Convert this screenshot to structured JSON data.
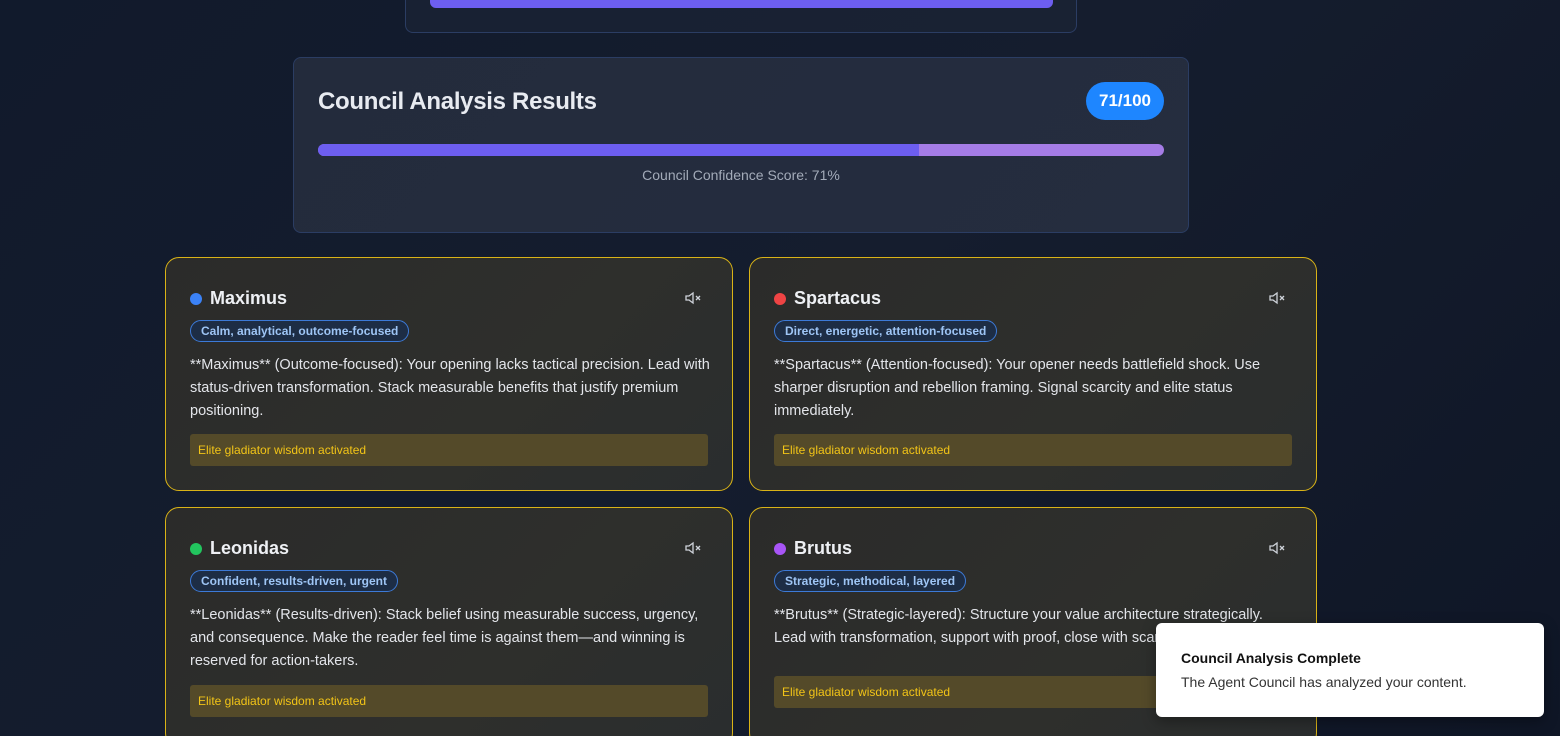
{
  "results": {
    "title": "Council Analysis Results",
    "score_badge": "71/100",
    "confidence_percent": 71,
    "score_label": "Council Confidence Score: 71%"
  },
  "agents": [
    {
      "name": "Maximus",
      "dot_color": "#3b82f6",
      "tag": "Calm, analytical, outcome-focused",
      "text": "**Maximus** (Outcome-focused): Your opening lacks tactical precision. Lead with status-driven transformation. Stack measurable benefits that justify premium positioning.",
      "banner": "Elite gladiator wisdom activated",
      "mute_icon": "speaker-muted-icon"
    },
    {
      "name": "Spartacus",
      "dot_color": "#ef4444",
      "tag": "Direct, energetic, attention-focused",
      "text": "**Spartacus** (Attention-focused): Your opener needs battlefield shock. Use sharper disruption and rebellion framing. Signal scarcity and elite status immediately.",
      "banner": "Elite gladiator wisdom activated",
      "mute_icon": "speaker-muted-icon"
    },
    {
      "name": "Leonidas",
      "dot_color": "#22c55e",
      "tag": "Confident, results-driven, urgent",
      "text": "**Leonidas** (Results-driven): Stack belief using measurable success, urgency, and consequence. Make the reader feel time is against them—and winning is reserved for action-takers.",
      "banner": "Elite gladiator wisdom activated",
      "mute_icon": "speaker-muted-icon"
    },
    {
      "name": "Brutus",
      "dot_color": "#a855f7",
      "tag": "Strategic, methodical, layered",
      "text": "**Brutus** (Strategic-layered): Structure your value architecture strategically. Lead with transformation, support with proof, close with scarcity-driv",
      "banner": "Elite gladiator wisdom activated",
      "mute_icon": "speaker-muted-icon"
    }
  ],
  "toast": {
    "title": "Council Analysis Complete",
    "description": "The Agent Council has analyzed your content."
  }
}
